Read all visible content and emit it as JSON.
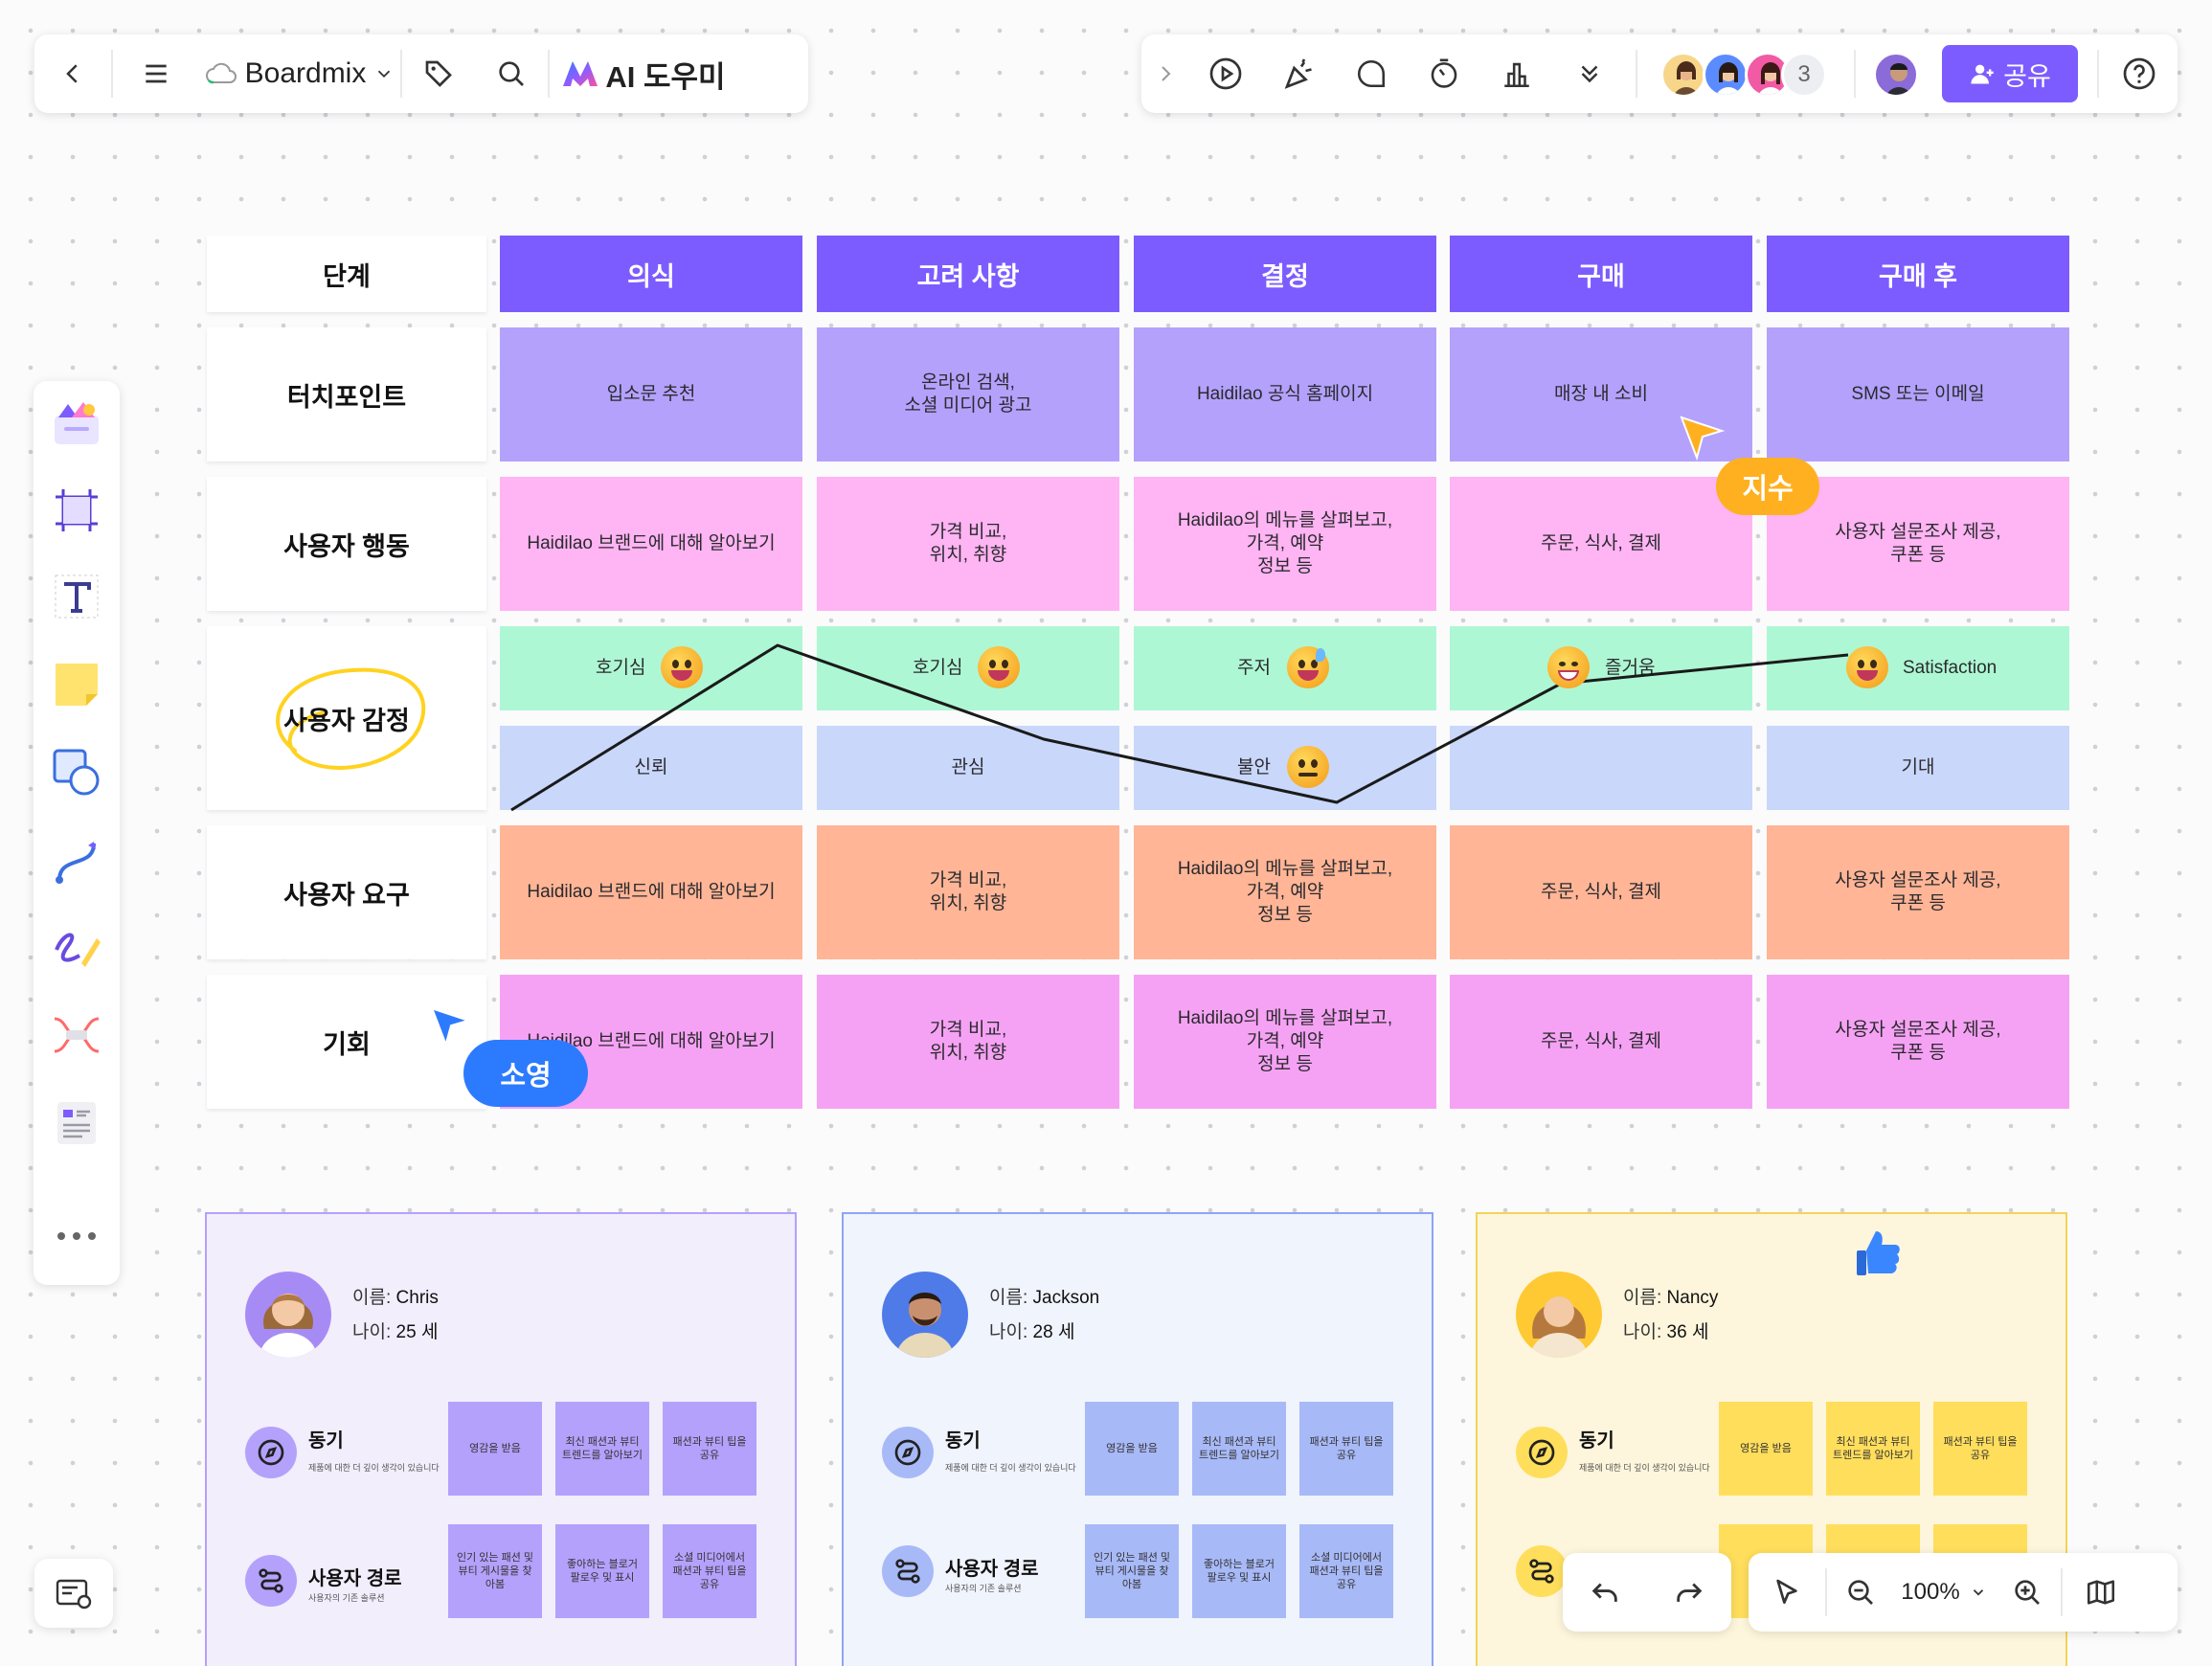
{
  "topbar": {
    "app_name": "Boardmix",
    "ai_label": "AI 도우미",
    "collaborator_count": "3",
    "share_label": "공유"
  },
  "journey": {
    "header_label": "단계",
    "stages": [
      "의식",
      "고려 사항",
      "결정",
      "구매",
      "구매 후"
    ],
    "rows": {
      "touchpoint": {
        "label": "터치포인트",
        "cells": [
          "입소문 추천",
          "온라인 검색,\n소셜 미디어 광고",
          "Haidilao 공식 홈페이지",
          "매장 내 소비",
          "SMS 또는 이메일"
        ]
      },
      "behavior": {
        "label": "사용자 행동",
        "cells": [
          "Haidilao 브랜드에 대해 알아보기",
          "가격 비교,\n위치, 취향",
          "Haidilao의 메뉴를 살펴보고,\n가격, 예약\n정보 등",
          "주문, 식사, 결제",
          "사용자 설문조사 제공,\n쿠폰 등"
        ]
      },
      "emotion": {
        "label": "사용자 감정",
        "top_cells": [
          "호기심",
          "호기심",
          "주저",
          "즐거움",
          "Satisfaction"
        ],
        "bottom_cells": [
          "신뢰",
          "관심",
          "불안",
          "",
          "기대"
        ]
      },
      "needs": {
        "label": "사용자 요구",
        "cells": [
          "Haidilao 브랜드에 대해 알아보기",
          "가격 비교,\n위치, 취향",
          "Haidilao의 메뉴를 살펴보고,\n가격, 예약\n정보 등",
          "주문, 식사, 결제",
          "사용자 설문조사 제공,\n쿠폰 등"
        ]
      },
      "opportunity": {
        "label": "기회",
        "cells": [
          "Haidilao 브랜드에 대해 알아보기",
          "가격 비교,\n위치, 취향",
          "Haidilao의 메뉴를 살펴보고,\n가격, 예약\n정보 등",
          "주문, 식사, 결제",
          "사용자 설문조사 제공,\n쿠폰 등"
        ]
      }
    },
    "colors": {
      "header": "#7c5cff",
      "touchpoint": "#b4a1fc",
      "behavior": "#ffb4f3",
      "emotion_top": "#aef7d4",
      "emotion_bottom": "#c9d7fb",
      "needs": "#ffb596",
      "opportunity": "#f6a2f4"
    }
  },
  "cursors": {
    "orange_user": "지수",
    "blue_user": "소영"
  },
  "personas": [
    {
      "name_label": "이름:",
      "name": "Chris",
      "age_label": "나이:",
      "age": "25 세",
      "motive_title": "동기",
      "motive_sub": "제품에 대한 더 깊이 생각이 있습니다",
      "path_title": "사용자 경로",
      "path_sub": "사용자의 기존 솔루션",
      "motive_notes": [
        "영감을 받음",
        "최신 패션과 뷰티 트렌드를 알아보기",
        "패션과 뷰티 팁을 공유"
      ],
      "path_notes": [
        "인기 있는 패션 및 뷰티 게시물을 찾아봄",
        "좋아하는 블로거 팔로우 및 표시",
        "소셜 미디어에서 패션과 뷰티 팁을 공유"
      ]
    },
    {
      "name_label": "이름:",
      "name": "Jackson",
      "age_label": "나이:",
      "age": "28 세",
      "motive_title": "동기",
      "motive_sub": "제품에 대한 더 깊이 생각이 있습니다",
      "path_title": "사용자 경로",
      "path_sub": "사용자의 기존 솔루션",
      "motive_notes": [
        "영감을 받음",
        "최신 패션과 뷰티 트렌드를 알아보기",
        "패션과 뷰티 팁을 공유"
      ],
      "path_notes": [
        "인기 있는 패션 및 뷰티 게시물을 찾아봄",
        "좋아하는 블로거 팔로우 및 표시",
        "소셜 미디어에서 패션과 뷰티 팁을 공유"
      ]
    },
    {
      "name_label": "이름:",
      "name": "Nancy",
      "age_label": "나이:",
      "age": "36 세",
      "motive_title": "동기",
      "motive_sub": "제품에 대한 더 깊이 생각이 있습니다",
      "motive_notes": [
        "영감을 받음",
        "최신 패션과 뷰티 트렌드를 알아보기",
        "패션과 뷰티 팁을 공유"
      ]
    }
  ],
  "zoom": {
    "level": "100%"
  }
}
